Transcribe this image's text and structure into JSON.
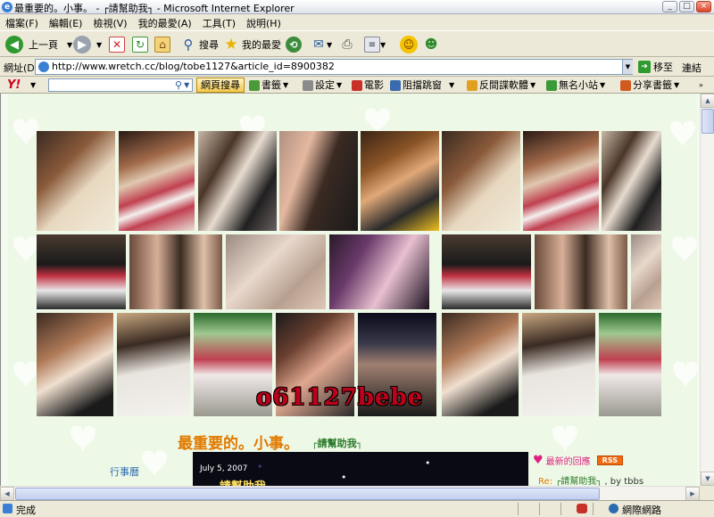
{
  "window": {
    "title": "最重要的。小事。 - ┌請幫助我┐ - Microsoft Internet Explorer",
    "minimize_glyph": "_",
    "maximize_glyph": "□",
    "close_glyph": "×"
  },
  "menu": [
    "檔案(F)",
    "編輯(E)",
    "檢視(V)",
    "我的最愛(A)",
    "工具(T)",
    "說明(H)"
  ],
  "toolbar": {
    "back_label": "上一頁",
    "search_label": "搜尋",
    "favorites_label": "我的最愛"
  },
  "address": {
    "label": "網址(D)",
    "url": "http://www.wretch.cc/blog/tobe1127&article_id=8900382",
    "go_label": "移至",
    "links_label": "連結"
  },
  "yahoo": {
    "logo": "Y!",
    "search_button": "網頁搜尋",
    "items": [
      "書籤",
      "設定",
      "電影",
      "阻擋跳窗",
      "反間諜軟體",
      "無名小站",
      "分享書籤"
    ]
  },
  "page": {
    "banner_text": "o61127bebe",
    "post_title": "最重要的。小事。",
    "post_tag": "┌請幫助我┐",
    "sidebar_left_label": "行事曆",
    "post_date": "July 5, 2007",
    "post_heading_partial": "┌請幫助我┐",
    "recent_replies_label": "最新的回應",
    "rss_label": "RSS",
    "reply_prefix": "Re:",
    "reply_title": "┌請幫助我┐",
    "reply_by": ", by tbbs"
  },
  "status": {
    "text": "完成",
    "zone": "網際網路"
  },
  "colors": {
    "accent_orange": "#e07a00",
    "link_blue": "#0033aa",
    "banner_red": "#c0001a",
    "rss_orange": "#f26a10"
  }
}
